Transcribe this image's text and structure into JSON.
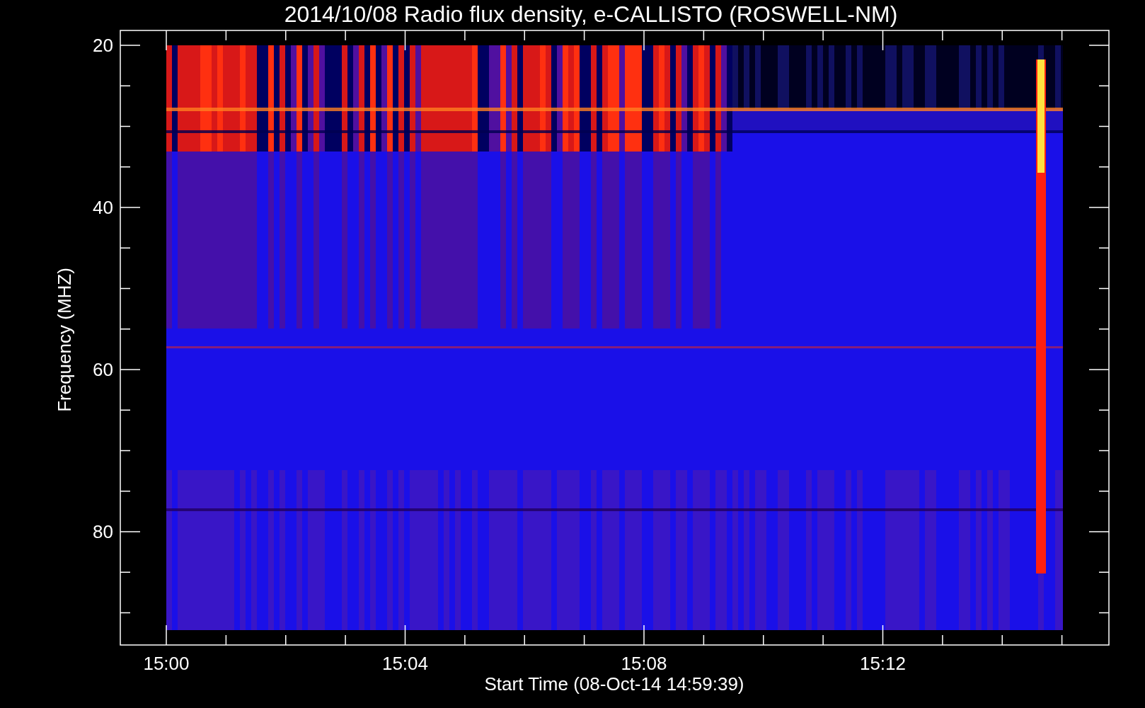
{
  "title": "2014/10/08  Radio flux density, e-CALLISTO (ROSWELL-NM)",
  "y_axis": {
    "label": "Frequency (MHZ)",
    "ticks": [
      "20",
      "40",
      "60",
      "80"
    ]
  },
  "x_axis": {
    "label": "Start Time (08-Oct-14 14:59:39)",
    "ticks": [
      "15:00",
      "15:04",
      "15:08",
      "15:12"
    ]
  }
}
